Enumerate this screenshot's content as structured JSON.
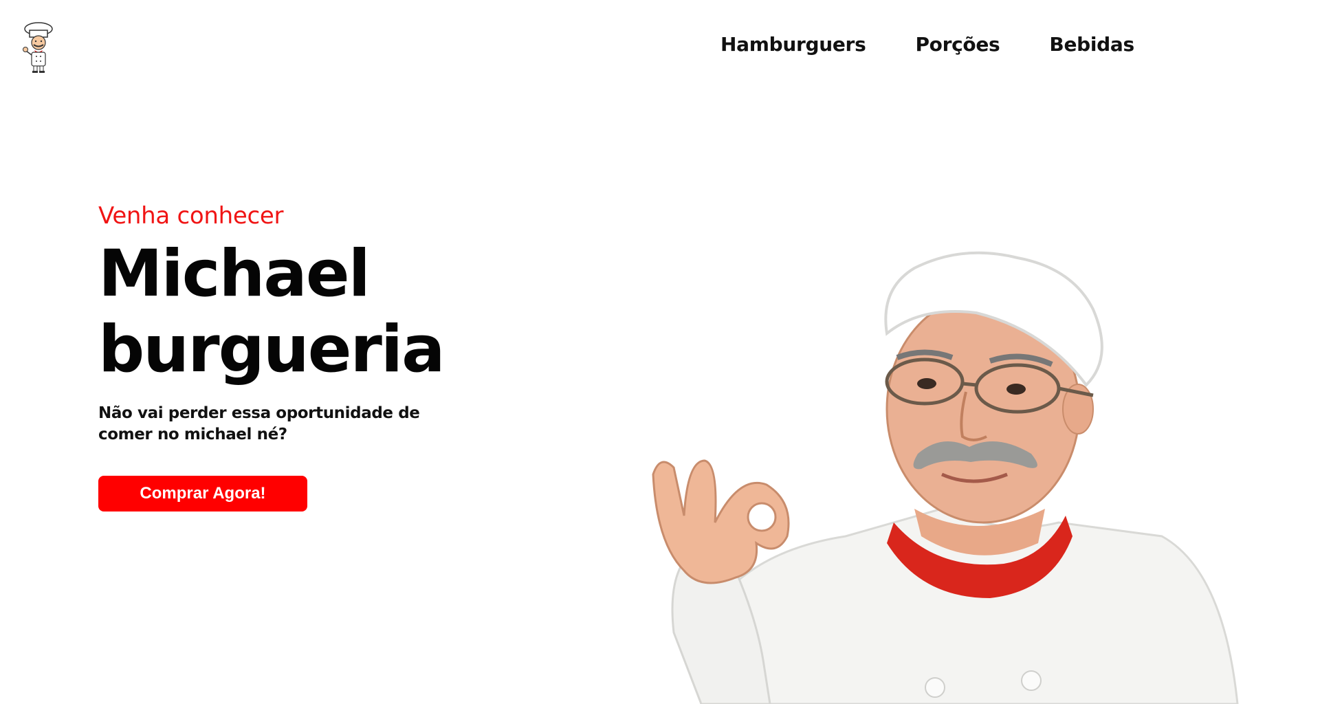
{
  "header": {
    "logo_icon": "chef-logo-icon",
    "nav": [
      {
        "label": "Hamburguers"
      },
      {
        "label": "Porções"
      },
      {
        "label": "Bebidas"
      }
    ]
  },
  "hero": {
    "kicker": "Venha conhecer",
    "title": "Michael burgueria",
    "subtitle": "Não vai perder essa oportunidade de comer no michael né?",
    "cta_label": "Comprar Agora!"
  },
  "colors": {
    "accent": "#ff0000",
    "text": "#050505",
    "background": "#ffffff"
  },
  "illustration": {
    "icon": "chef-ok-gesture-photo"
  }
}
